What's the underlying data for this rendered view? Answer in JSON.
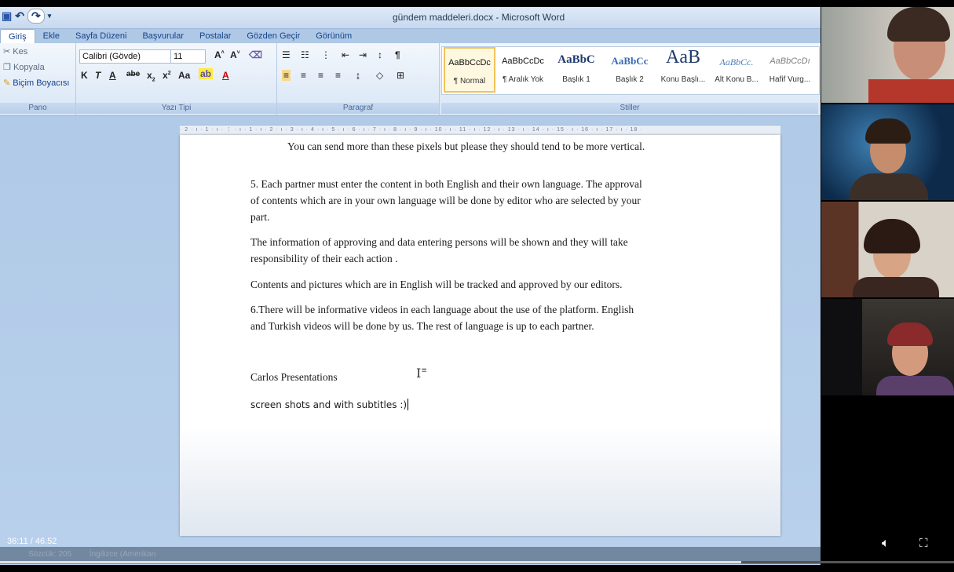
{
  "app": {
    "window_title": "gündem maddeleri.docx - Microsoft Word"
  },
  "quick_access": {
    "save": "💾",
    "undo": "↶",
    "redo": "↷"
  },
  "ribbon_tabs": [
    "Giriş",
    "Ekle",
    "Sayfa Düzeni",
    "Başvurular",
    "Postalar",
    "Gözden Geçir",
    "Görünüm"
  ],
  "clipboard": {
    "cut": "Kes",
    "copy": "Kopyala",
    "format_painter": "Biçim Boyacısı",
    "label": "Pano"
  },
  "font": {
    "name": "Calibri (Gövde)",
    "size": "11",
    "label": "Yazı Tipi"
  },
  "paragraph": {
    "label": "Paragraf"
  },
  "styles": {
    "label": "Stiller",
    "items": [
      {
        "preview": "AaBbCcDc",
        "name": "¶ Normal"
      },
      {
        "preview": "AaBbCcDc",
        "name": "¶ Aralık Yok"
      },
      {
        "preview": "AaBbC",
        "name": "Başlık 1"
      },
      {
        "preview": "AaBbCc",
        "name": "Başlık 2"
      },
      {
        "preview": "AaB",
        "name": "Konu Başlı..."
      },
      {
        "preview": "AaBbCc.",
        "name": "Alt Konu B..."
      },
      {
        "preview": "AaBbCcDı",
        "name": "Hafif Vurg..."
      }
    ]
  },
  "ruler": "· 2 · ı · 1 · ı · ⋮ · ı · 1 · ı · 2 · ı · 3 · ı · 4 · ı · 5 · ı · 6 · ı · 7 · ı · 8 · ı · 9 · ı · 10 · ı · 11 · ı · 12 · ı · 13 · ı · 14 · ı · 15 · ı · 16 · ı · 17 · ı · 18 ·",
  "document": {
    "line_top": "You can send more than these pixels  but please they should tend to be more vertical.",
    "para5": [
      "5. Each partner must enter  the content in both English and their own language. The approval",
      "of contents which are in your own language will be done by editor who are selected by your",
      "part."
    ],
    "info": [
      "The information of approving and data entering persons will be shown and they will take",
      "responsibility of their each action ."
    ],
    "contents": "Contents and pictures which are in English will be tracked and approved by our editors.",
    "para6": [
      "6.There will be informative videos in each language about the use of the platform.  English",
      "and Turkish videos will be done by us. The rest of language is up to each partner."
    ],
    "carlos": "Carlos Presentations",
    "screenshots": "screen shots and with subtitles :)"
  },
  "statusbar": {
    "words": "Sözcük: 205",
    "language": "İngilizce (Amerikan"
  },
  "video": {
    "time": "36:11 / 46.52",
    "progress": 0.777,
    "volume_icon": "speaker-icon",
    "fullscreen_icon": "fullscreen-icon"
  }
}
